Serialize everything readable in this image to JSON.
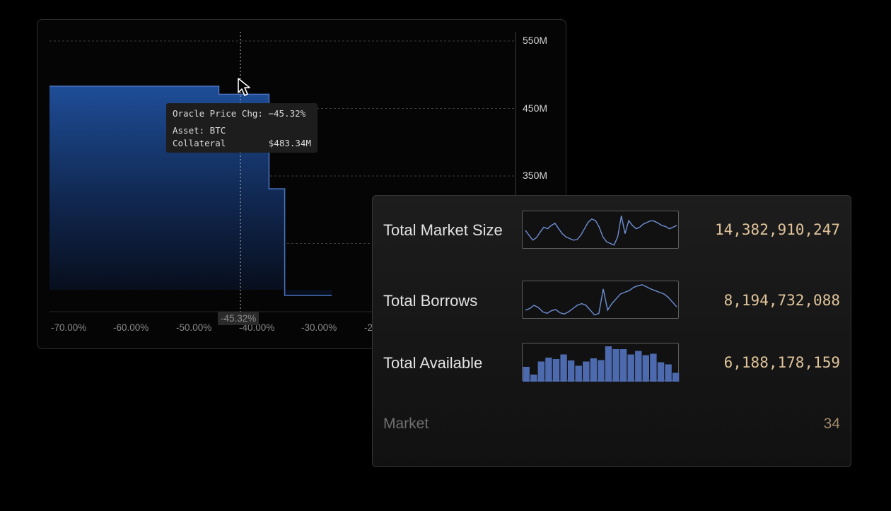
{
  "chart": {
    "y_ticks": [
      "550M",
      "450M",
      "350M"
    ],
    "x_ticks": [
      "-70.00%",
      "-60.00%",
      "-50.00%",
      "-40.00%",
      "-30.00%",
      "-2"
    ],
    "hover_x_label": "-45.32%",
    "tooltip": {
      "title": "Oracle Price Chg: −45.32%",
      "asset": "Asset: BTC",
      "collateral_label": "Collateral",
      "collateral_value": "$483.34M"
    },
    "fill_color": "#1e4d97"
  },
  "chart_data": {
    "type": "area",
    "step": true,
    "x": [
      -70.0,
      -43.0,
      -43.0,
      -35.0,
      -35.0,
      -32.5,
      -32.5,
      -30.0,
      -25.0
    ],
    "y": [
      483,
      483,
      471,
      471,
      331,
      331,
      173,
      173,
      173
    ],
    "x_unit": "%",
    "y_unit": "M",
    "ylim": [
      200,
      580
    ],
    "grid": true
  },
  "stats": {
    "rows": [
      {
        "label": "Total Market Size",
        "value": "14,382,910,247"
      },
      {
        "label": "Total Borrows",
        "value": "8,194,732,088"
      },
      {
        "label": "Total Available",
        "value": "6,188,178,159"
      }
    ],
    "market_label": "Market",
    "market_value": "34",
    "spark_color": "#6f8fd4",
    "bar_color": "#4d6aae"
  },
  "sparklines": {
    "market_size": [
      0.5,
      0.35,
      0.2,
      0.28,
      0.45,
      0.6,
      0.55,
      0.65,
      0.72,
      0.55,
      0.4,
      0.3,
      0.25,
      0.2,
      0.22,
      0.35,
      0.55,
      0.75,
      0.85,
      0.8,
      0.6,
      0.3,
      0.15,
      0.1,
      0.05,
      0.3,
      0.95,
      0.4,
      0.8,
      0.65,
      0.55,
      0.6,
      0.7,
      0.75,
      0.8,
      0.78,
      0.72,
      0.65,
      0.62,
      0.55,
      0.6,
      0.65
    ],
    "borrows": [
      0.2,
      0.25,
      0.35,
      0.28,
      0.15,
      0.1,
      0.18,
      0.22,
      0.12,
      0.08,
      0.15,
      0.25,
      0.35,
      0.4,
      0.35,
      0.2,
      0.05,
      0.1,
      0.85,
      0.2,
      0.4,
      0.55,
      0.7,
      0.75,
      0.8,
      0.9,
      0.95,
      0.98,
      0.92,
      0.85,
      0.8,
      0.75,
      0.7,
      0.6,
      0.45,
      0.3
    ],
    "available": [
      0.42,
      0.2,
      0.57,
      0.68,
      0.64,
      0.77,
      0.6,
      0.45,
      0.57,
      0.66,
      0.61,
      1.0,
      0.92,
      0.92,
      0.77,
      0.87,
      0.75,
      0.79,
      0.55,
      0.49,
      0.25
    ]
  }
}
